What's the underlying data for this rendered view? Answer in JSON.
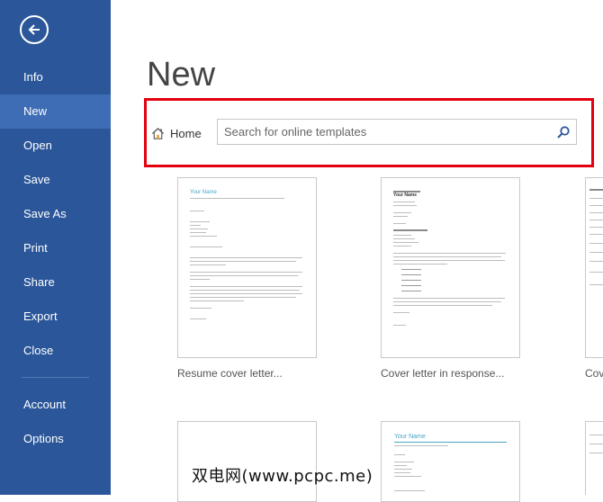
{
  "backstage": {
    "nav": [
      {
        "label": "Info"
      },
      {
        "label": "New"
      },
      {
        "label": "Open"
      },
      {
        "label": "Save"
      },
      {
        "label": "Save As"
      },
      {
        "label": "Print"
      },
      {
        "label": "Share"
      },
      {
        "label": "Export"
      },
      {
        "label": "Close"
      },
      {
        "label": "Account"
      },
      {
        "label": "Options"
      }
    ],
    "active_item": "New"
  },
  "main": {
    "title": "New",
    "home_label": "Home",
    "search_placeholder": "Search for online templates"
  },
  "templates": [
    {
      "label": "Resume cover letter...",
      "heading": "Your Name"
    },
    {
      "label": "Cover letter in response...",
      "heading": "Your Name"
    },
    {
      "label": "Cove"
    },
    {
      "label": ""
    },
    {
      "heading": "Your Name"
    }
  ],
  "watermark": "双电网(www.pcpc.me)",
  "colors": {
    "sidebar": "#2b579a",
    "sidebar_active": "#3e6db5",
    "highlight": "#e3000f",
    "template_accent": "#4aa3c8"
  }
}
